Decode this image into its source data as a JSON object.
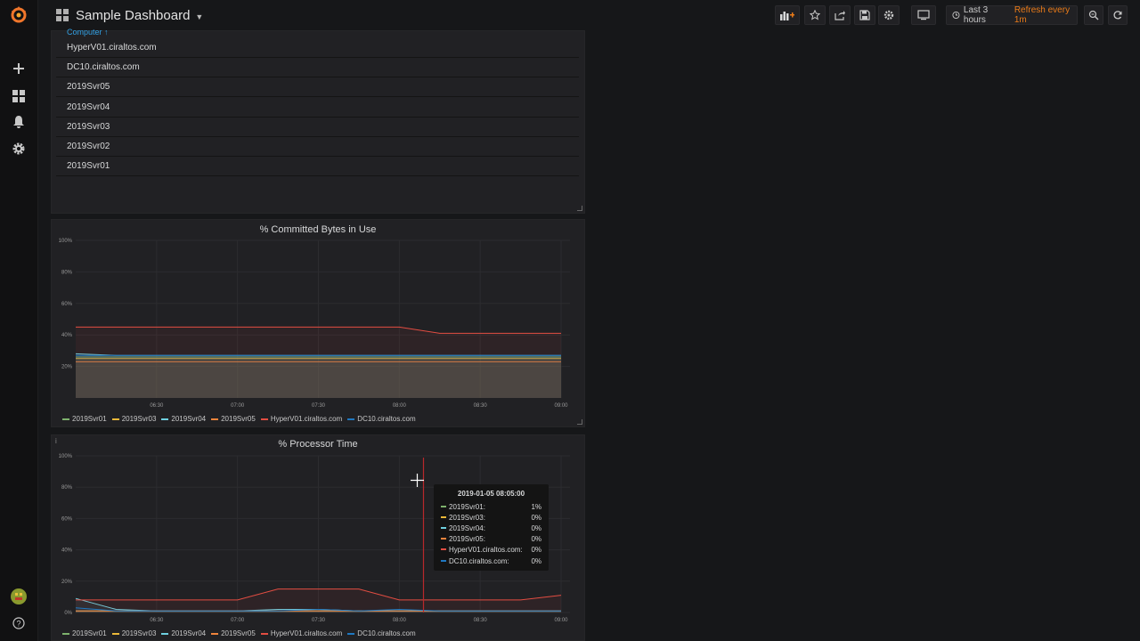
{
  "colors": {
    "accent": "#eb7b18",
    "link": "#33a2e5",
    "series": [
      "#7eb26d",
      "#eab839",
      "#6ed0e0",
      "#ef843c",
      "#e24d42",
      "#1f78c1"
    ]
  },
  "sidebar": {
    "items": [
      {
        "icon": "grafana-logo-icon"
      },
      {
        "icon": "plus-icon"
      },
      {
        "icon": "dashboards-icon"
      },
      {
        "icon": "bell-icon"
      },
      {
        "icon": "gear-icon"
      },
      {
        "icon": "user-avatar-icon"
      },
      {
        "icon": "help-icon"
      }
    ]
  },
  "navbar": {
    "title": "Sample Dashboard",
    "time_range": "Last 3 hours",
    "refresh": "Refresh every 1m",
    "buttons": [
      "add-panel-icon",
      "star-icon",
      "share-icon",
      "save-icon",
      "settings-icon",
      "tv-mode-icon",
      "zoom-out-icon",
      "refresh-icon"
    ]
  },
  "table_panel": {
    "column_header": "Computer ↑",
    "rows": [
      "HyperV01.ciraltos.com",
      "DC10.ciraltos.com",
      "2019Svr05",
      "2019Svr04",
      "2019Svr03",
      "2019Svr02",
      "2019Svr01"
    ]
  },
  "chart_data": [
    {
      "type": "area",
      "title": "% Committed Bytes in Use",
      "ylim": [
        0,
        100
      ],
      "y_ticks": [
        "20%",
        "40%",
        "60%",
        "80%",
        "100%"
      ],
      "x_ticks": [
        "06:30",
        "07:00",
        "07:30",
        "08:00",
        "08:30",
        "09:00"
      ],
      "x": [
        "06:00",
        "06:15",
        "06:30",
        "06:45",
        "07:00",
        "07:15",
        "07:30",
        "07:45",
        "08:00",
        "08:15",
        "08:30",
        "08:45",
        "09:00"
      ],
      "grid": true,
      "legend_position": "bottom",
      "series": [
        {
          "name": "2019Svr01",
          "values": [
            26,
            26,
            26,
            26,
            26,
            26,
            26,
            26,
            26,
            26,
            26,
            26,
            26
          ]
        },
        {
          "name": "2019Svr03",
          "values": [
            25,
            25,
            25,
            25,
            25,
            25,
            25,
            25,
            25,
            25,
            25,
            25,
            25
          ]
        },
        {
          "name": "2019Svr04",
          "values": [
            28,
            27,
            27,
            27,
            27,
            27,
            27,
            27,
            27,
            27,
            27,
            27,
            27
          ]
        },
        {
          "name": "2019Svr05",
          "values": [
            23,
            23,
            23,
            23,
            23,
            23,
            23,
            23,
            23,
            23,
            23,
            23,
            23
          ]
        },
        {
          "name": "HyperV01.ciraltos.com",
          "values": [
            45,
            45,
            45,
            45,
            45,
            45,
            45,
            45,
            45,
            41,
            41,
            41,
            41
          ]
        },
        {
          "name": "DC10.ciraltos.com",
          "values": [
            27,
            27,
            27,
            27,
            27,
            27,
            27,
            27,
            27,
            27,
            27,
            27,
            27
          ]
        }
      ]
    },
    {
      "type": "area",
      "title": "% Processor Time",
      "ylim": [
        0,
        100
      ],
      "y_ticks": [
        "0%",
        "20%",
        "40%",
        "60%",
        "80%",
        "100%"
      ],
      "x_ticks": [
        "06:30",
        "07:00",
        "07:30",
        "08:00",
        "08:30",
        "09:00"
      ],
      "x": [
        "06:00",
        "06:15",
        "06:30",
        "06:45",
        "07:00",
        "07:15",
        "07:30",
        "07:45",
        "08:00",
        "08:15",
        "08:30",
        "08:45",
        "09:00"
      ],
      "grid": true,
      "legend_position": "bottom",
      "series": [
        {
          "name": "2019Svr01",
          "values": [
            1,
            1,
            1,
            1,
            1,
            1,
            1,
            1,
            1,
            1,
            1,
            1,
            1
          ]
        },
        {
          "name": "2019Svr03",
          "values": [
            1,
            1,
            1,
            1,
            1,
            1,
            1,
            1,
            1,
            1,
            1,
            1,
            1
          ]
        },
        {
          "name": "2019Svr04",
          "values": [
            9,
            2,
            1,
            1,
            1,
            2,
            2,
            1,
            1,
            1,
            1,
            1,
            1
          ]
        },
        {
          "name": "2019Svr05",
          "values": [
            1,
            1,
            1,
            1,
            1,
            1,
            1,
            1,
            1,
            1,
            1,
            1,
            1
          ]
        },
        {
          "name": "HyperV01.ciraltos.com",
          "values": [
            8,
            8,
            8,
            8,
            8,
            15,
            15,
            15,
            8,
            8,
            8,
            8,
            11
          ]
        },
        {
          "name": "DC10.ciraltos.com",
          "values": [
            3,
            1,
            1,
            1,
            1,
            1,
            2,
            1,
            2,
            1,
            1,
            1,
            1
          ]
        }
      ]
    }
  ],
  "tooltip": {
    "time": "2019-01-05 08:05:00",
    "rows": [
      {
        "name": "2019Svr01:",
        "value": "1%"
      },
      {
        "name": "2019Svr03:",
        "value": "0%"
      },
      {
        "name": "2019Svr04:",
        "value": "0%"
      },
      {
        "name": "2019Svr05:",
        "value": "0%"
      },
      {
        "name": "HyperV01.ciraltos.com:",
        "value": "0%"
      },
      {
        "name": "DC10.ciraltos.com:",
        "value": "0%"
      }
    ]
  }
}
